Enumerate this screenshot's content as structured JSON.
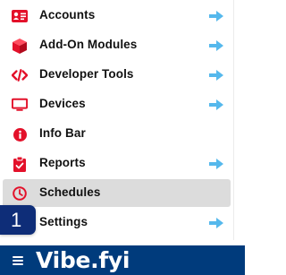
{
  "menu": {
    "items": [
      {
        "label": "Accounts",
        "icon": "id-card-icon",
        "has_submenu": true
      },
      {
        "label": "Add-On Modules",
        "icon": "cube-icon",
        "has_submenu": true
      },
      {
        "label": "Developer Tools",
        "icon": "code-icon",
        "has_submenu": true
      },
      {
        "label": "Devices",
        "icon": "monitor-icon",
        "has_submenu": true
      },
      {
        "label": "Info Bar",
        "icon": "info-icon",
        "has_submenu": false
      },
      {
        "label": "Reports",
        "icon": "clipboard-check-icon",
        "has_submenu": true
      },
      {
        "label": "Schedules",
        "icon": "clock-icon",
        "has_submenu": false,
        "active": true
      },
      {
        "label": "Settings",
        "icon": "gear-icon",
        "has_submenu": true
      }
    ]
  },
  "step_badge": "1",
  "bottom_bar": {
    "brand": "Vibe.fyi",
    "menu_icon": "hamburger-icon"
  },
  "colors": {
    "icon_red": "#e3112a",
    "chevron_blue": "#55b8ec",
    "active_bg": "#dcdcdc",
    "bar_blue": "#003b7c",
    "badge_blue": "#0e2d78"
  }
}
